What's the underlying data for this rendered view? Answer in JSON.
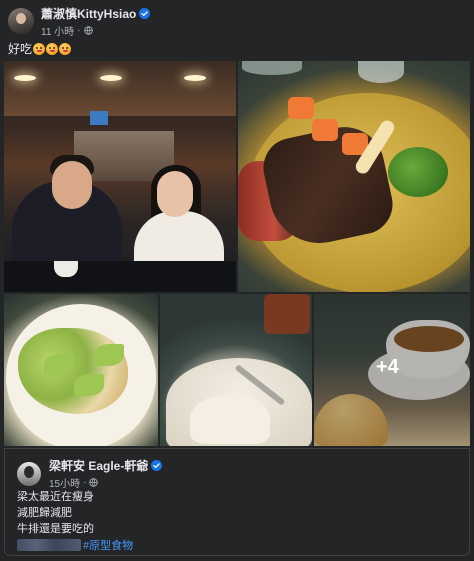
{
  "post": {
    "author": "蕭淑慎KittyHsiao",
    "time": "11 小時",
    "text": "好吃",
    "emoji_count": 3,
    "photos": [
      {
        "name": "restaurant-couple-photo"
      },
      {
        "name": "steak-plate-photo"
      },
      {
        "name": "salad-photo"
      },
      {
        "name": "rice-bowl-photo"
      },
      {
        "name": "soup-bread-photo"
      }
    ],
    "more_photos_label": "+4"
  },
  "shared": {
    "author": "梁軒安 Eagle-軒爺",
    "time": "15小時",
    "lines": [
      "梁太最近在瘦身",
      "減肥歸減肥",
      "牛排還是要吃的"
    ],
    "hashtag": "#原型食物"
  },
  "colors": {
    "background": "#242526",
    "text_primary": "#e4e6eb",
    "text_secondary": "#b0b3b8",
    "verified_blue": "#1b74e4",
    "hashtag_blue": "#4599ff"
  }
}
